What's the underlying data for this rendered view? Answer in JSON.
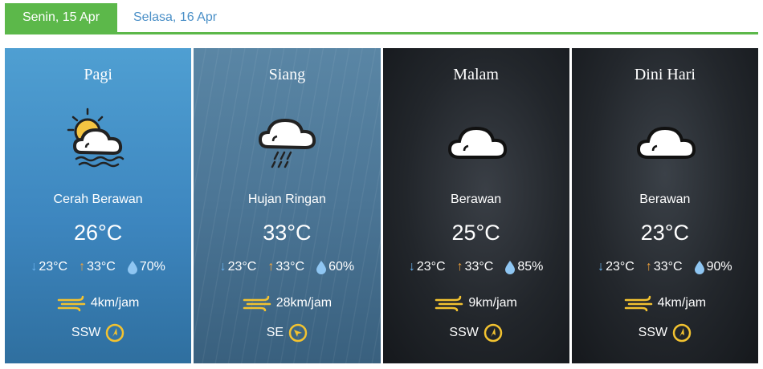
{
  "tabs": [
    {
      "label": "Senin, 15 Apr",
      "active": true
    },
    {
      "label": "Selasa, 16 Apr",
      "active": false
    }
  ],
  "colors": {
    "accent": "#5cb84a",
    "link": "#4a8fc7",
    "arrow_down": "#6bb3ee",
    "arrow_up": "#f0a23a",
    "wind_icon": "#f2c230"
  },
  "cards": [
    {
      "period": "Pagi",
      "icon": "partly-cloudy-sun-icon",
      "condition": "Cerah Berawan",
      "temp": "26°C",
      "min": "23°C",
      "max": "33°C",
      "humidity": "70%",
      "wind_speed": "4km/jam",
      "wind_dir": "SSW"
    },
    {
      "period": "Siang",
      "icon": "light-rain-cloud-icon",
      "condition": "Hujan Ringan",
      "temp": "33°C",
      "min": "23°C",
      "max": "33°C",
      "humidity": "60%",
      "wind_speed": "28km/jam",
      "wind_dir": "SE"
    },
    {
      "period": "Malam",
      "icon": "cloud-icon",
      "condition": "Berawan",
      "temp": "25°C",
      "min": "23°C",
      "max": "33°C",
      "humidity": "85%",
      "wind_speed": "9km/jam",
      "wind_dir": "SSW"
    },
    {
      "period": "Dini Hari",
      "icon": "cloud-icon",
      "condition": "Berawan",
      "temp": "23°C",
      "min": "23°C",
      "max": "33°C",
      "humidity": "90%",
      "wind_speed": "4km/jam",
      "wind_dir": "SSW"
    }
  ]
}
